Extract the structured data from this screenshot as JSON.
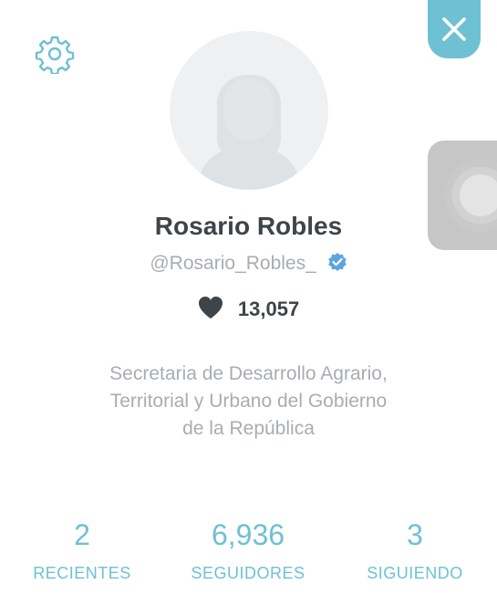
{
  "profile": {
    "name": "Rosario Robles",
    "handle": "@Rosario_Robles_",
    "verified": true,
    "likes": "13,057",
    "bio": "Secretaria de Desarrollo Agrario,\nTerritorial  y Urbano del Gobierno\nde la República"
  },
  "stats": [
    {
      "value": "2",
      "label": "RECIENTES"
    },
    {
      "value": "6,936",
      "label": "SEGUIDORES"
    },
    {
      "value": "3",
      "label": "SIGUIENDO"
    }
  ],
  "icons": {
    "settings": "gear-icon",
    "close": "close-icon",
    "verified": "verified-badge-icon",
    "likes": "heart-icon",
    "avatar": "default-avatar-icon"
  },
  "colors": {
    "accent": "#6ec1d3",
    "name_text": "#3f4449",
    "secondary_text": "#a8adb3",
    "verified_badge": "#5ba4e0",
    "avatar_bg": "#eef0f2",
    "avatar_silhouette": "#dfe2e5",
    "side_tab": "#c6c6c6"
  }
}
